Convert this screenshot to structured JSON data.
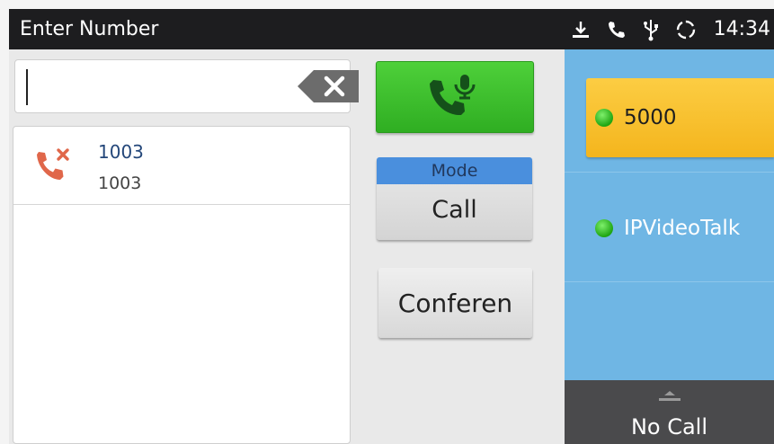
{
  "statusbar": {
    "title": "Enter Number",
    "time": "14:34"
  },
  "input": {
    "value": ""
  },
  "history": [
    {
      "name": "1003",
      "number": "1003",
      "type": "missed"
    }
  ],
  "actions": {
    "mode_header": "Mode",
    "mode_value": "Call",
    "conference_label": "Conferen"
  },
  "accounts": [
    {
      "label": "5000",
      "active": true,
      "status_color": "#2fbf1f"
    },
    {
      "label": "IPVideoTalk",
      "active": false,
      "status_color": "#2fbf1f"
    }
  ],
  "call_status": {
    "label": "No Call"
  },
  "colors": {
    "dial_green": "#3fc12d",
    "missed_red": "#e0674a",
    "active_account": "#f8c02e",
    "accounts_bg": "#6fb6e4",
    "mode_blue": "#4a8fdd"
  }
}
